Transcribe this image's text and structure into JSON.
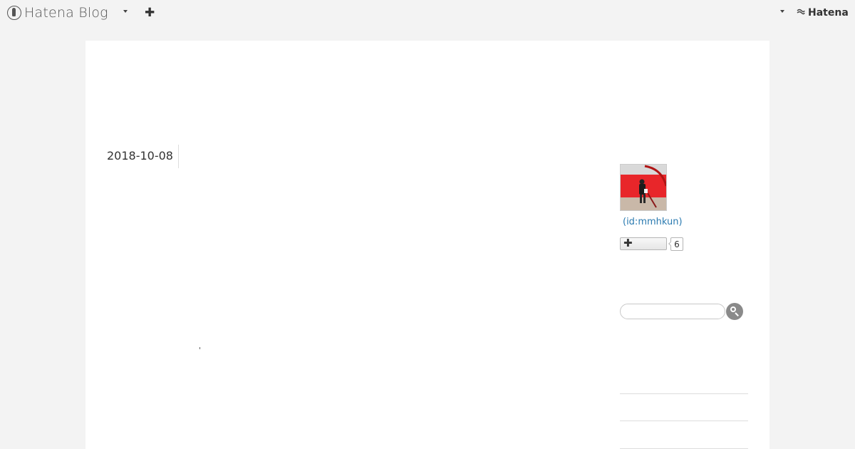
{
  "header": {
    "brand": "Hatena Blog",
    "hatena_label": "Hatena",
    "icons": {
      "brand": "hatena-blog-logo-icon",
      "menu_caret": "chevron-down-icon",
      "new_post": "plus-icon",
      "account_caret": "chevron-down-icon",
      "hatena": "hatena-logo-icon"
    }
  },
  "entry": {
    "date": "2018-10-08"
  },
  "sidebar": {
    "author_id": "(id:mmhkun)",
    "subscriber_count": "6",
    "search": {
      "placeholder": "",
      "value": ""
    }
  },
  "colors": {
    "page_bg": "#f3f3f3",
    "container_bg": "#ffffff",
    "link": "#2a7ab0",
    "avatar_red": "#e8262a"
  }
}
